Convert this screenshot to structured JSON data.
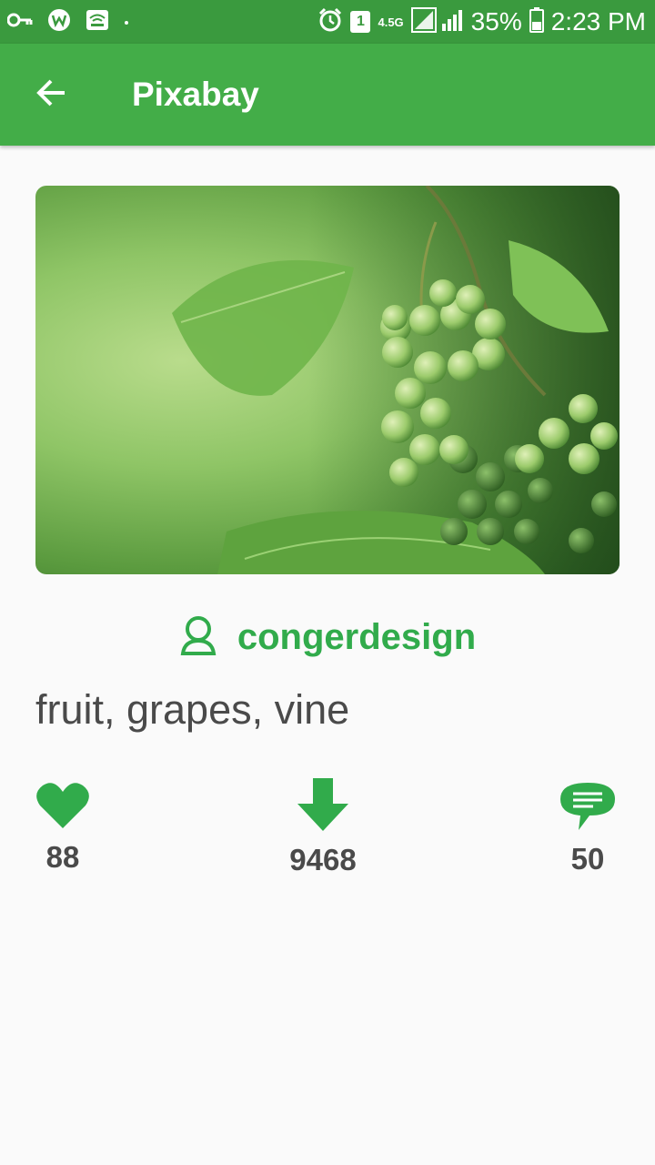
{
  "status_bar": {
    "network_type": "4.5G",
    "sim_slot": "1",
    "battery": "35%",
    "time": "2:23 PM",
    "icons": [
      "key-icon",
      "vpn-icon",
      "wifi-calling-icon",
      "dot-icon",
      "alarm-icon",
      "sim-icon",
      "signal-icon",
      "battery-icon"
    ]
  },
  "app_bar": {
    "title": "Pixabay",
    "back_icon": "arrow-back-icon"
  },
  "image": {
    "subject": "green grapes on vine"
  },
  "author": {
    "name": "congerdesign",
    "icon": "user-icon"
  },
  "tags": "fruit, grapes, vine",
  "stats": {
    "likes": "88",
    "downloads": "9468",
    "comments": "50"
  },
  "colors": {
    "status_bar": "#3a9a3e",
    "app_bar": "#43ad48",
    "accent": "#31ab4b",
    "text": "#4a4a4a",
    "background": "#fafafa"
  }
}
